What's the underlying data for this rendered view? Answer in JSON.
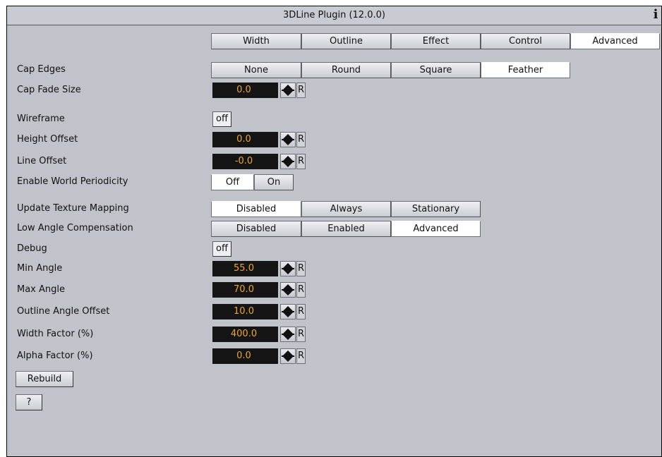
{
  "window": {
    "title": "3DLine Plugin (12.0.0)",
    "info_icon": "i"
  },
  "tabs": [
    "Width",
    "Outline",
    "Effect",
    "Control",
    "Advanced"
  ],
  "tabs_active": "Advanced",
  "cap_edges": {
    "label": "Cap Edges",
    "options": [
      "None",
      "Round",
      "Square",
      "Feather"
    ],
    "selected": "Feather"
  },
  "cap_fade_size": {
    "label": "Cap Fade Size",
    "value": "0.0",
    "reset": "R"
  },
  "wireframe": {
    "label": "Wireframe",
    "value": "off"
  },
  "height_offset": {
    "label": "Height Offset",
    "value": "0.0",
    "reset": "R"
  },
  "line_offset": {
    "label": "Line Offset",
    "value": "-0.0",
    "reset": "R"
  },
  "world_periodicity": {
    "label": "Enable World Periodicity",
    "options": [
      "Off",
      "On"
    ],
    "selected": "Off"
  },
  "update_texture_mapping": {
    "label": "Update Texture Mapping",
    "options": [
      "Disabled",
      "Always",
      "Stationary"
    ],
    "selected": "Disabled"
  },
  "low_angle_compensation": {
    "label": "Low Angle Compensation",
    "options": [
      "Disabled",
      "Enabled",
      "Advanced"
    ],
    "selected": "Advanced"
  },
  "debug": {
    "label": "Debug",
    "value": "off"
  },
  "min_angle": {
    "label": "Min Angle",
    "value": "55.0",
    "reset": "R"
  },
  "max_angle": {
    "label": "Max Angle",
    "value": "70.0",
    "reset": "R"
  },
  "outline_angle_offset": {
    "label": "Outline Angle Offset",
    "value": "10.0",
    "reset": "R"
  },
  "width_factor": {
    "label": "Width Factor (%)",
    "value": "400.0",
    "reset": "R"
  },
  "alpha_factor": {
    "label": "Alpha Factor (%)",
    "value": "0.0",
    "reset": "R"
  },
  "rebuild_label": "Rebuild",
  "help_label": "?",
  "colors": {
    "panel_bg": "#c0c3c9",
    "value_bg": "#141414",
    "value_text": "#f0a626"
  }
}
